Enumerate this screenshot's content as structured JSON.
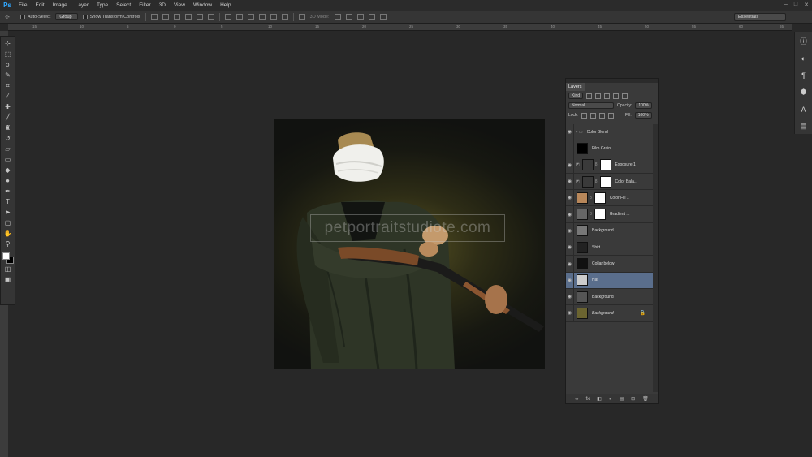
{
  "app": {
    "logo": "Ps"
  },
  "menu": [
    "File",
    "Edit",
    "Image",
    "Layer",
    "Type",
    "Select",
    "Filter",
    "3D",
    "View",
    "Window",
    "Help"
  ],
  "window_controls": [
    "–",
    "□",
    "✕"
  ],
  "options": {
    "tool_glyph": "⊹",
    "auto_select_label": "Auto-Select",
    "group_value": "Group",
    "show_transform_label": "Show Transform Controls",
    "mode_3d_label": "3D Mode:",
    "workspace_value": "Essentials"
  },
  "ruler": [
    "15",
    "10",
    "5",
    "0",
    "5",
    "10",
    "15",
    "20",
    "25",
    "30",
    "35",
    "40",
    "45",
    "50",
    "55",
    "60",
    "65"
  ],
  "canvas": {
    "watermark": "petportraitstudiote.com"
  },
  "layers_panel": {
    "tab_label": "Layers",
    "filter_label": "Kind",
    "blend_mode": "Normal",
    "opacity_label": "Opacity:",
    "opacity_value": "100%",
    "lock_label": "Lock:",
    "fill_label": "Fill:",
    "fill_value": "100%",
    "layers": [
      {
        "name": "Color Blend",
        "thumb": "#3a3a3a",
        "mask": false,
        "group": true
      },
      {
        "name": "Film Grain",
        "thumb": "#000000",
        "mask": false
      },
      {
        "name": "Exposure 1",
        "thumb": "#3a3a3a",
        "mask": true,
        "adjust": true
      },
      {
        "name": "Color Bala...",
        "thumb": "#3a3a3a",
        "mask": true,
        "adjust": true
      },
      {
        "name": "Color Fill 1",
        "thumb": "#b8875a",
        "mask": true
      },
      {
        "name": "Gradient ...",
        "thumb": "#666666",
        "mask": true
      },
      {
        "name": "Background",
        "thumb": "#777777",
        "mask": false
      },
      {
        "name": "Shirt",
        "thumb": "#222222",
        "mask": false
      },
      {
        "name": "Collar below",
        "thumb": "#111111",
        "mask": false
      },
      {
        "name": "Hat",
        "thumb": "#cccccc",
        "mask": false,
        "selected": true
      },
      {
        "name": "Background",
        "thumb": "#555555",
        "mask": false
      },
      {
        "name": "Background",
        "thumb": "#6b6430",
        "mask": false,
        "italic": true,
        "locked": true
      }
    ],
    "bottom_icons": [
      "∞",
      "fx",
      "◧",
      "◐",
      "▤",
      "⊞",
      "🗑"
    ]
  }
}
